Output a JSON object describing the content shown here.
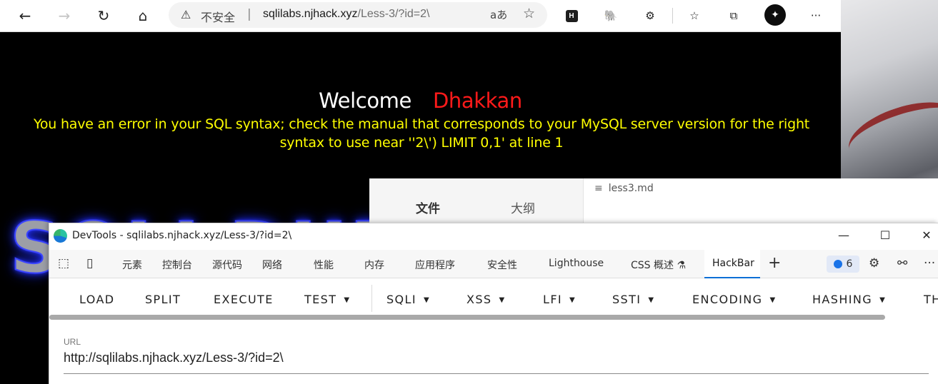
{
  "browser": {
    "insecure_label": "不安全",
    "url_host": "sqlilabs.njhack.xyz",
    "url_path": "/Less-3/?id=2\\",
    "separator": "|",
    "read_aloud": "aあ"
  },
  "page": {
    "welcome": "Welcome",
    "name": "Dhakkan",
    "error_line1": "You have an error in your SQL syntax; check the manual that corresponds to your MySQL server version for the right",
    "error_line2": "syntax to use near ''2\\') LIMIT 0,1' at line 1",
    "logo_text": "SQLI DUMB"
  },
  "markdown_app": {
    "tab_files": "文件",
    "tab_outline": "大纲",
    "doc_name": "less3.md"
  },
  "devtools": {
    "title": "DevTools - sqlilabs.njhack.xyz/Less-3/?id=2\\",
    "tabs": [
      "元素",
      "控制台",
      "源代码",
      "网络",
      "性能",
      "内存",
      "应用程序",
      "安全性",
      "Lighthouse",
      "CSS 概述",
      "HackBar"
    ],
    "active_tab": "HackBar",
    "issues_count": "6"
  },
  "hackbar": {
    "buttons": [
      "LOAD",
      "SPLIT",
      "EXECUTE"
    ],
    "menus": [
      "TEST",
      "SQLI",
      "XSS",
      "LFI",
      "SSTI",
      "ENCODING",
      "HASHING",
      "TH"
    ],
    "url_label": "URL",
    "url_value": "http://sqlilabs.njhack.xyz/Less-3/?id=2\\"
  },
  "colors": {
    "welcome": "#ffffff",
    "name": "#ff1a1a",
    "error": "#ffff00",
    "page_bg": "#000000",
    "accent": "#0c6fd6"
  }
}
